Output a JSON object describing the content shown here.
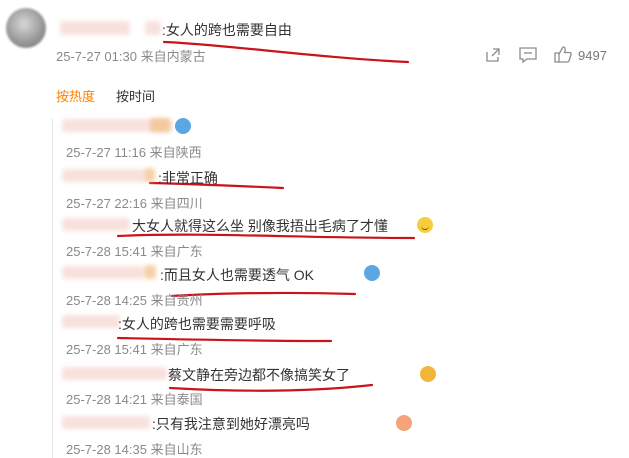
{
  "post": {
    "text": ":女人的跨也需要自由",
    "meta": "25-7-27 01:30 来自内蒙古",
    "like_count": "9497",
    "icons": [
      "share-icon",
      "comment-icon",
      "like-icon"
    ]
  },
  "tabs": [
    {
      "label": "按热度",
      "active": true
    },
    {
      "label": "按时间",
      "active": false
    }
  ],
  "replies": [
    {
      "text": "",
      "meta": "25-7-27 11:16 来自陕西",
      "emoji": "hug-emoji"
    },
    {
      "text": ":非常正确",
      "meta": "25-7-27 22:16 来自四川",
      "emoji": ""
    },
    {
      "text": "大女人就得这么坐 别像我捂出毛病了才懂",
      "meta": "25-7-28 15:41 来自广东",
      "emoji": "smile-emoji"
    },
    {
      "text": ":而且女人也需要透气 OK",
      "meta": "25-7-28 14:25 来自贵州",
      "emoji": "hug-emoji"
    },
    {
      "text": ":女人的跨也需要需要呼吸",
      "meta": "25-7-28 15:41 来自广东",
      "emoji": ""
    },
    {
      "text": "蔡文静在旁边都不像搞笑女了",
      "meta": "25-7-28 14:21 来自泰国",
      "emoji": "laugh-cry-emoji"
    },
    {
      "text": ":只有我注意到她好漂亮吗",
      "meta": "25-7-28 14:35 来自山东",
      "emoji": "love-emoji"
    }
  ],
  "colors": {
    "accent": "#ff8200",
    "underline": "#c9141a"
  }
}
